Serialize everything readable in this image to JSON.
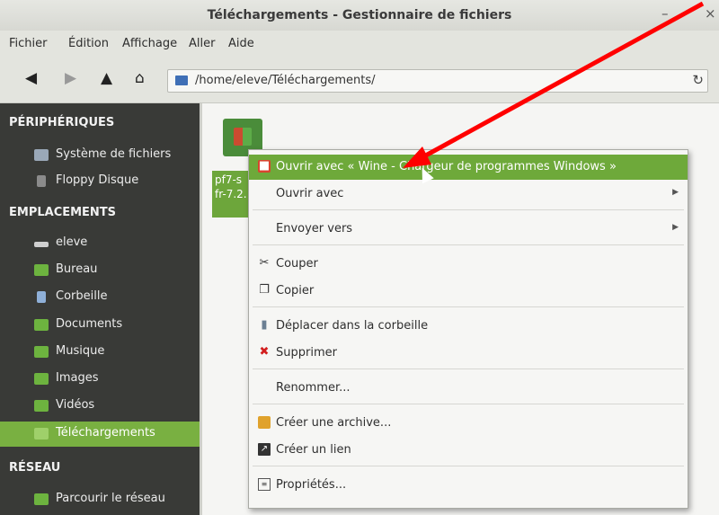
{
  "window": {
    "title": "Téléchargements - Gestionnaire de fichiers"
  },
  "menubar": [
    "Fichier",
    "Édition",
    "Affichage",
    "Aller",
    "Aide"
  ],
  "toolbar": {
    "path": "/home/eleve/Téléchargements/"
  },
  "sidebar": {
    "devices_header": "PÉRIPHÉRIQUES",
    "devices": [
      {
        "label": "Système de fichiers",
        "icon": "drive-icon",
        "color": "#9aa8b8"
      },
      {
        "label": "Floppy Disque",
        "icon": "floppy-icon",
        "color": "#8b8b8b"
      }
    ],
    "places_header": "EMPLACEMENTS",
    "places": [
      {
        "label": "eleve",
        "icon": "home-icon",
        "color": "#cfcfcf"
      },
      {
        "label": "Bureau",
        "icon": "desktop-icon",
        "color": "#6db33f"
      },
      {
        "label": "Corbeille",
        "icon": "trash-icon",
        "color": "#8fb0d8"
      },
      {
        "label": "Documents",
        "icon": "folder-icon",
        "color": "#6db33f"
      },
      {
        "label": "Musique",
        "icon": "folder-icon",
        "color": "#6db33f"
      },
      {
        "label": "Images",
        "icon": "folder-icon",
        "color": "#6db33f"
      },
      {
        "label": "Vidéos",
        "icon": "folder-icon",
        "color": "#6db33f"
      },
      {
        "label": "Téléchargements",
        "icon": "folder-icon",
        "color": "#6db33f",
        "active": true
      }
    ],
    "network_header": "RÉSEAU",
    "network": [
      {
        "label": "Parcourir le réseau",
        "icon": "network-icon",
        "color": "#6db33f"
      }
    ]
  },
  "file": {
    "name": "pf7-s fr-7.2."
  },
  "context_menu": [
    {
      "label": "Ouvrir avec « Wine - Chargeur de programmes Windows »",
      "icon": "wine-icon",
      "highlighted": true
    },
    {
      "label": "Ouvrir avec",
      "submenu": true
    },
    {
      "label": "Envoyer vers",
      "submenu": true
    },
    {
      "label": "Couper",
      "icon": "scissors-icon"
    },
    {
      "label": "Copier",
      "icon": "copy-icon"
    },
    {
      "label": "Déplacer dans la corbeille",
      "icon": "trash-icon"
    },
    {
      "label": "Supprimer",
      "icon": "delete-icon"
    },
    {
      "label": "Renommer..."
    },
    {
      "label": "Créer une archive...",
      "icon": "archive-icon"
    },
    {
      "label": "Créer un lien",
      "icon": "link-icon"
    },
    {
      "label": "Propriétés...",
      "icon": "properties-icon"
    }
  ],
  "colors": {
    "accent": "#6ea93a",
    "sidebar_bg": "#393a37",
    "annotation_arrow": "#ff0000"
  }
}
